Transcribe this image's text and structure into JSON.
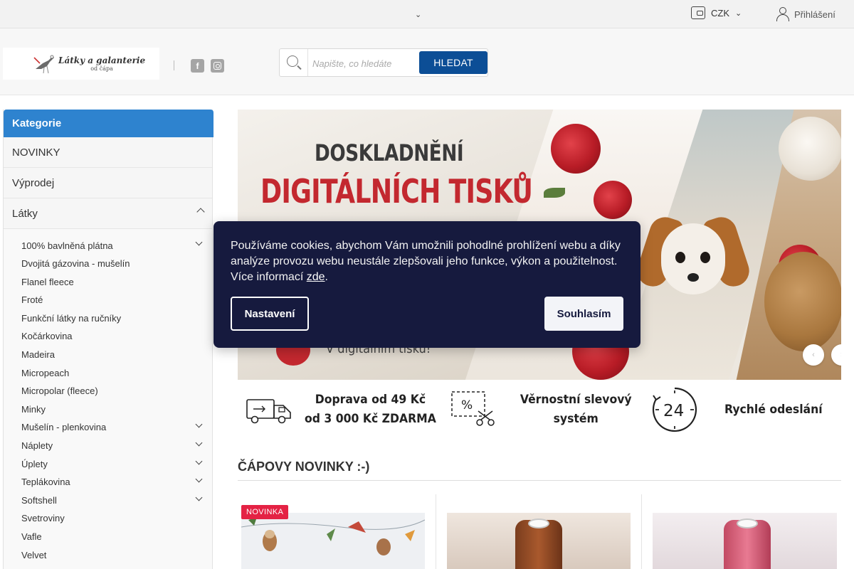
{
  "topbar": {
    "currency": "CZK",
    "login": "Přihlášení",
    "icons": [
      "chevron-down-icon",
      "wallet-icon",
      "user-icon"
    ]
  },
  "header": {
    "logo": {
      "title": "Látky a galanterie",
      "subtitle": "od čápa"
    },
    "social": [
      "facebook-icon",
      "instagram-icon"
    ],
    "search": {
      "placeholder": "Napište, co hledáte",
      "button": "HLEDAT"
    }
  },
  "sidebar": {
    "title": "Kategorie",
    "top_items": [
      {
        "label": "NOVINKY"
      },
      {
        "label": "Výprodej"
      },
      {
        "label": "Látky",
        "expanded": true
      }
    ],
    "subitems": [
      {
        "label": "100% bavlněná plátna",
        "has_children": true
      },
      {
        "label": "Dvojitá gázovina - mušelín",
        "has_children": false
      },
      {
        "label": "Flanel fleece",
        "has_children": false
      },
      {
        "label": "Froté",
        "has_children": false
      },
      {
        "label": "Funkční látky na ručníky",
        "has_children": false
      },
      {
        "label": "Kočárkovina",
        "has_children": false
      },
      {
        "label": "Madeira",
        "has_children": false
      },
      {
        "label": "Micropeach",
        "has_children": false
      },
      {
        "label": "Micropolar (fleece)",
        "has_children": false
      },
      {
        "label": "Minky",
        "has_children": false
      },
      {
        "label": "Mušelín - plenkovina",
        "has_children": true
      },
      {
        "label": "Náplety",
        "has_children": true
      },
      {
        "label": "Úplety",
        "has_children": true
      },
      {
        "label": "Teplákovina",
        "has_children": true
      },
      {
        "label": "Softshell",
        "has_children": true
      },
      {
        "label": "Svetroviny",
        "has_children": false
      },
      {
        "label": "Vafle",
        "has_children": false
      },
      {
        "label": "Velvet",
        "has_children": false
      }
    ]
  },
  "banner": {
    "line1": "DOSKLADNĚNÍ",
    "line2": "DIGITÁLNÍCH TISKŮ",
    "line3": "V digitálním tisku!"
  },
  "benefits": [
    {
      "line1": "Doprava od 49 Kč",
      "line2": "od 3 000 Kč ZDARMA",
      "icon": "truck-icon"
    },
    {
      "line1": "Věrnostní slevový",
      "line2": "systém",
      "icon": "coupon-scissors-icon"
    },
    {
      "line1": "Rychlé odeslání",
      "line2": "",
      "icon": "24-hours-icon",
      "icon_text": "24"
    }
  ],
  "section": {
    "title": "ČÁPOVY NOVINKY :-)",
    "badge": "NOVINKA"
  },
  "cookie": {
    "text": "Používáme cookies, abychom Vám umožnili pohodlné prohlížení webu a díky analýze provozu webu neustále zlepšovali jeho funkce, výkon a použitelnost. Více informací ",
    "link": "zde",
    "suffix": ".",
    "settings": "Nastavení",
    "accept": "Souhlasím"
  },
  "colors": {
    "primary": "#0c4e96",
    "category": "#2e83cf",
    "cookie_bg": "#161a3e",
    "badge": "#e42244"
  }
}
